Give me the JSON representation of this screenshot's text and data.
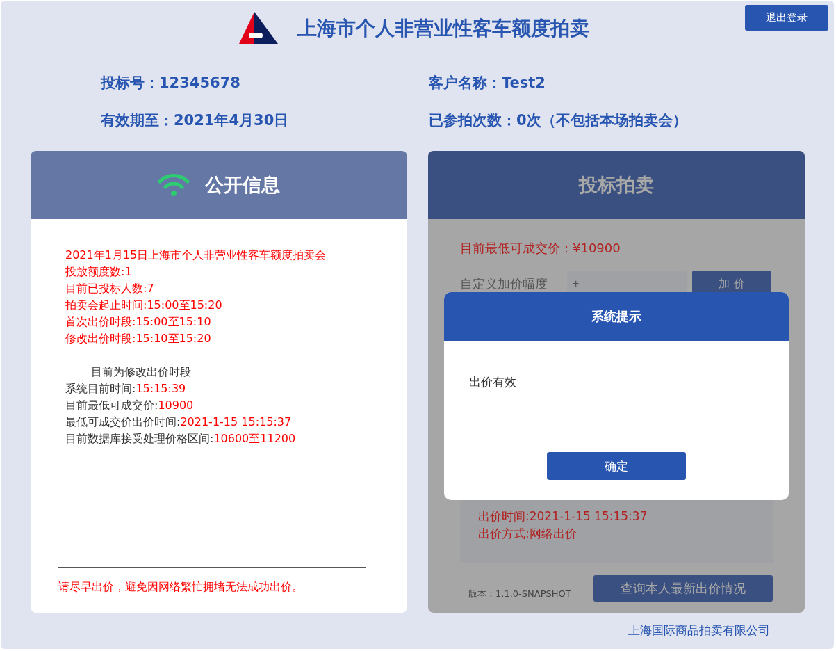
{
  "header": {
    "title": "上海市个人非营业性客车额度拍卖",
    "logout_button": "退出登录"
  },
  "user_info": [
    {
      "label": "投标号：",
      "value": "12345678"
    },
    {
      "label": "客户名称：",
      "value": "Test2"
    },
    {
      "label": "有效期至：",
      "value": "2021年4月30日"
    },
    {
      "label": "已参拍次数：",
      "value": "0次（不包括本场拍卖会）"
    }
  ],
  "public_panel": {
    "title": "公开信息",
    "lines": [
      {
        "kind": "notice",
        "text": "2021年1月15日上海市个人非营业性客车额度拍卖会"
      },
      {
        "kind": "notice",
        "text": "投放额度数:1"
      },
      {
        "kind": "notice",
        "text": "目前已投标人数:7"
      },
      {
        "kind": "notice",
        "text": "拍卖会起止时间:15:00至15:20"
      },
      {
        "kind": "notice",
        "text": "首次出价时段:15:00至15:10"
      },
      {
        "kind": "notice",
        "text": "修改出价时段:15:10至15:20"
      },
      {
        "kind": "gap"
      },
      {
        "kind": "status",
        "text": "目前为修改出价时段"
      },
      {
        "kind": "pair",
        "label": "系统目前时间:",
        "value": "15:15:39"
      },
      {
        "kind": "pair",
        "label": "目前最低可成交价:",
        "value": "10900"
      },
      {
        "kind": "pair",
        "label": "最低可成交价出价时间:",
        "value": "2021-1-15 15:15:37"
      },
      {
        "kind": "pair",
        "label": "目前数据库接受处理价格区间:",
        "value": "10600至11200"
      }
    ],
    "warning": "请尽早出价，避免因网络繁忙拥堵无法成功出价。"
  },
  "bid_panel": {
    "title": "投标拍卖",
    "lowest_price": "目前最低可成交价：¥10900",
    "increment_label": "自定义加价幅度",
    "increment_placeholder": "+",
    "add_button": "加 价",
    "bid_lines": [
      "出价时间:2021-1-15 15:15:37",
      "出价方式:网络出价"
    ],
    "version": "版本：1.1.0-SNAPSHOT",
    "query_button": "查询本人最新出价情况"
  },
  "dialog": {
    "title": "系统提示",
    "message": "出价有效",
    "ok_button": "确定"
  },
  "footer": {
    "company": "上海国际商品拍卖有限公司"
  }
}
